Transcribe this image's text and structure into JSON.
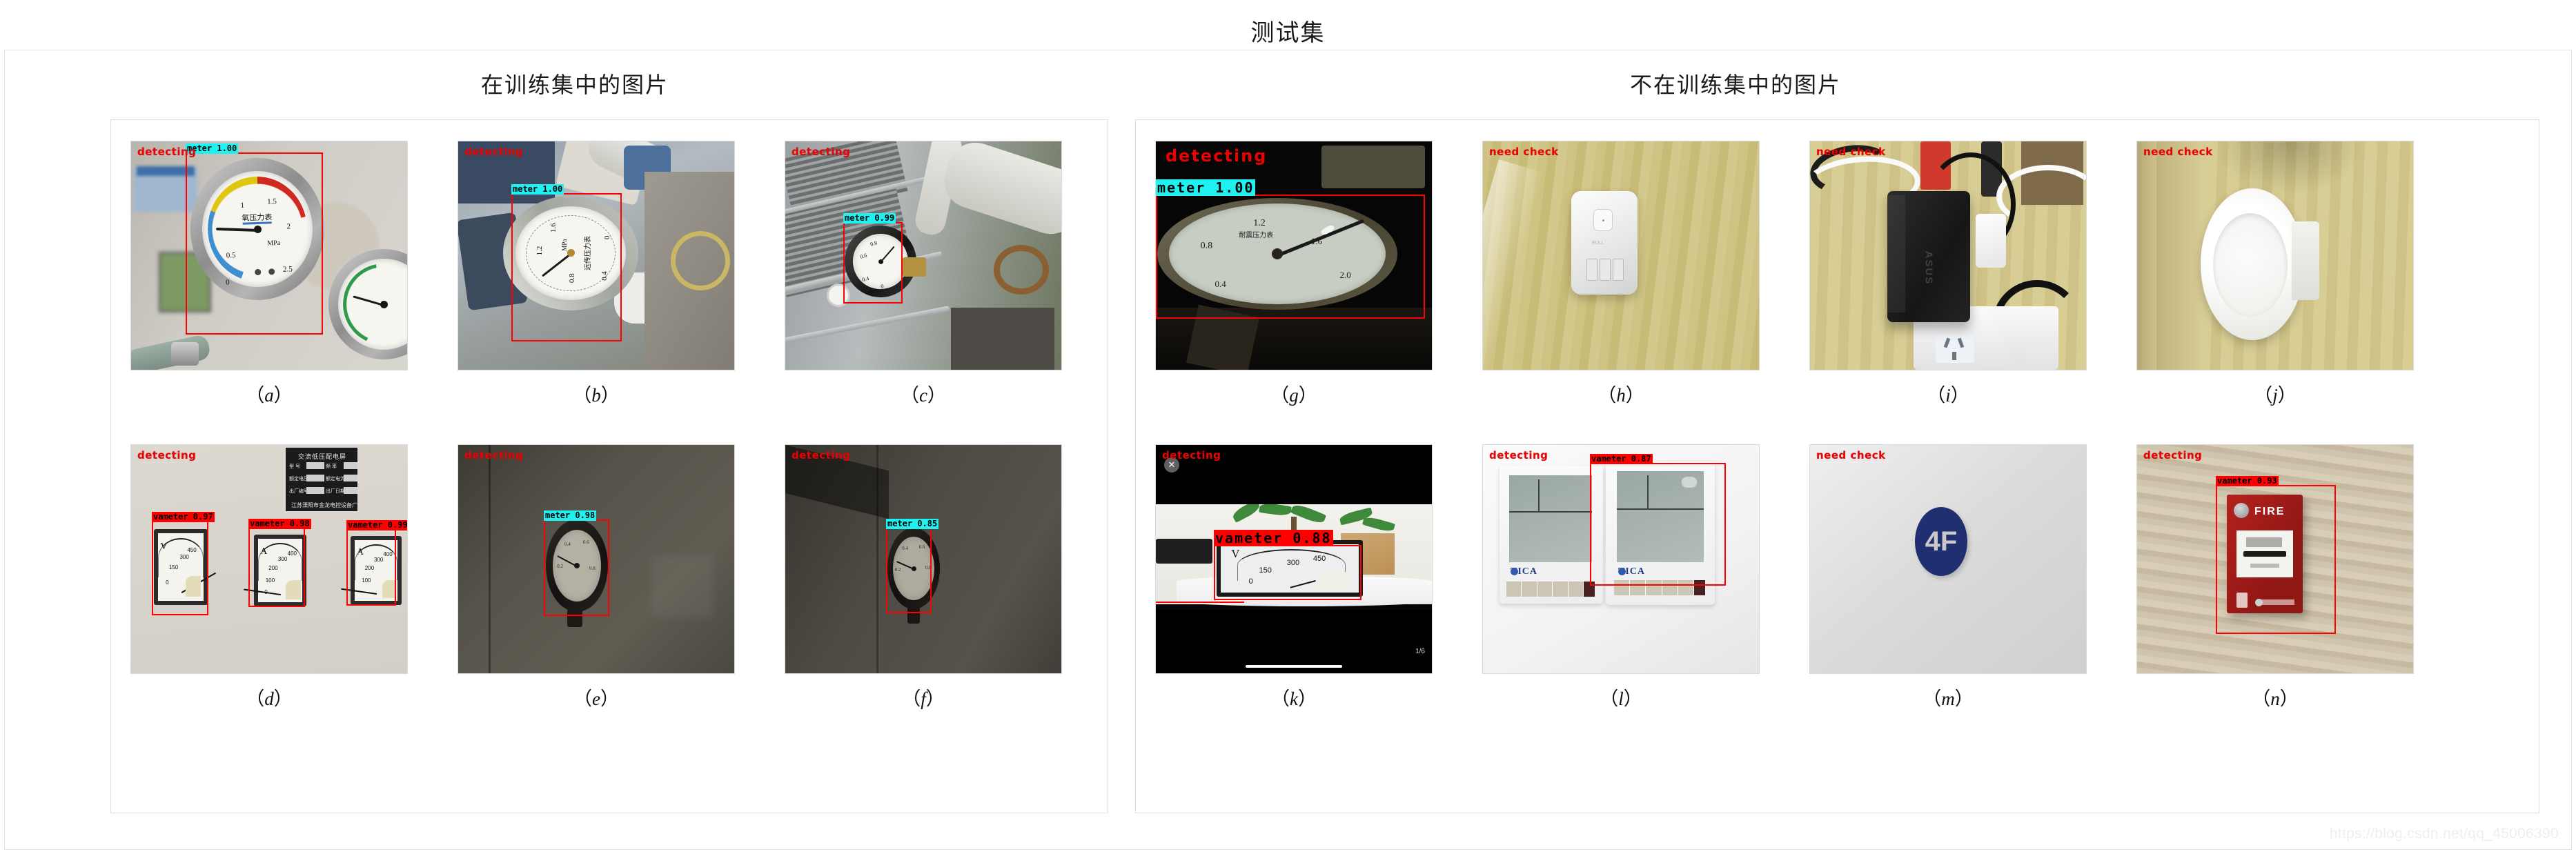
{
  "page": {
    "title": "测试集",
    "watermark": "https://blog.csdn.net/qq_45006390"
  },
  "sections": {
    "left_header": "在训练集中的图片",
    "right_header": "不在训练集中的图片"
  },
  "labels": {
    "detecting": "detecting",
    "need_check": "need check"
  },
  "figures": [
    {
      "id": "a",
      "caption_letter": "a",
      "status": "detecting",
      "status_color": "#ee0000",
      "detections": [
        {
          "label": "meter 1.00",
          "class": "meter",
          "score": "1.00",
          "color": "cyan"
        }
      ],
      "scene": "oxygen pressure gauge on regulator, blurred lab background"
    },
    {
      "id": "b",
      "caption_letter": "b",
      "status": "detecting",
      "status_color": "#ee0000",
      "detections": [
        {
          "label": "meter 1.00",
          "class": "meter",
          "score": "1.00",
          "color": "cyan"
        }
      ],
      "scene": "rotated remote transmission pressure gauge on pump piping"
    },
    {
      "id": "c",
      "caption_letter": "c",
      "status": "detecting",
      "status_color": "#ee0000",
      "detections": [
        {
          "label": "meter 0.99",
          "class": "meter",
          "score": "0.99",
          "color": "cyan"
        }
      ],
      "scene": "small black pressure gauge on outdoor pipe rack"
    },
    {
      "id": "d",
      "caption_letter": "d",
      "status": "detecting",
      "status_color": "#ee0000",
      "detections": [
        {
          "label": "vameter 0.97",
          "class": "vameter",
          "score": "0.97",
          "color": "red"
        },
        {
          "label": "vameter 0.98",
          "class": "vameter",
          "score": "0.98",
          "color": "red"
        },
        {
          "label": "vameter 0.99",
          "class": "vameter",
          "score": "0.99",
          "color": "red"
        }
      ],
      "scene": "three panel meters (V, A, A) on switchgear cabinet with nameplate"
    },
    {
      "id": "e",
      "caption_letter": "e",
      "status": "detecting",
      "status_color": "#ee0000",
      "detections": [
        {
          "label": "meter 0.98",
          "class": "meter",
          "score": "0.98",
          "color": "cyan"
        }
      ],
      "scene": "pressure gauge on dim wall"
    },
    {
      "id": "f",
      "caption_letter": "f",
      "status": "detecting",
      "status_color": "#ee0000",
      "detections": [
        {
          "label": "meter 0.85",
          "class": "meter",
          "score": "0.85",
          "color": "cyan"
        }
      ],
      "scene": "pressure gauge on dark wall"
    },
    {
      "id": "g",
      "caption_letter": "g",
      "status": "detecting",
      "status_color": "#ee0000",
      "detections": [
        {
          "label": "meter 1.00",
          "class": "meter",
          "score": "1.00",
          "color": "cyan"
        }
      ],
      "scene": "large close-up gauge in very dark room"
    },
    {
      "id": "h",
      "caption_letter": "h",
      "status": "need check",
      "status_color": "#ee0000",
      "detections": [],
      "scene": "white BULL usb charger on wooden desk"
    },
    {
      "id": "i",
      "caption_letter": "i",
      "status": "need check",
      "status_color": "#ee0000",
      "detections": [],
      "scene": "black ASUS power adapter on power strip with cables"
    },
    {
      "id": "j",
      "caption_letter": "j",
      "status": "need check",
      "status_color": "#ee0000",
      "detections": [],
      "scene": "white plastic vent cap on wooden panel"
    },
    {
      "id": "k",
      "caption_letter": "k",
      "status": "detecting",
      "status_color": "#ee0000",
      "detections": [
        {
          "label": "vameter 0.88",
          "class": "vameter",
          "score": "0.88",
          "color": "red"
        }
      ],
      "scene": "phone video of voltmeter on desk with plant, letterboxed",
      "overlay": {
        "counter": "1/6",
        "close": "✕"
      }
    },
    {
      "id": "l",
      "caption_letter": "l",
      "status": "detecting",
      "status_color": "#ee0000",
      "detections": [
        {
          "label": "vameter 0.87",
          "class": "vameter",
          "score": "0.87",
          "color": "red"
        }
      ],
      "scene": "two TICA wall thermostats",
      "brand": "TICA"
    },
    {
      "id": "m",
      "caption_letter": "m",
      "status": "need check",
      "status_color": "#ee0000",
      "detections": [],
      "scene": "4F floor sign on white wall",
      "sign_text": "4F"
    },
    {
      "id": "n",
      "caption_letter": "n",
      "status": "detecting",
      "status_color": "#ee0000",
      "detections": [
        {
          "label": "vameter 0.93",
          "class": "vameter",
          "score": "0.93",
          "color": "red"
        }
      ],
      "scene": "red FIRE manual call point on marble wall",
      "sign_text": "FIRE"
    }
  ],
  "gauge_a": {
    "dial_title": "氧压力表",
    "unit": "MPa",
    "ticks": [
      "0",
      "0.5",
      "1",
      "1.5",
      "2",
      "2.5"
    ]
  },
  "gauge_b": {
    "dial_title": "远传压力表",
    "unit": "MPa",
    "ticks": [
      "0",
      "0.4",
      "0.8",
      "1.2",
      "1.6"
    ]
  },
  "meter_d": {
    "units": [
      "V",
      "A",
      "A"
    ],
    "ticks_v": [
      "0",
      "150",
      "300",
      "450"
    ],
    "ticks_a": [
      "0",
      "100",
      "200",
      "300",
      "400"
    ]
  },
  "meter_k": {
    "unit": "V",
    "ticks": [
      "0",
      "150",
      "300",
      "450"
    ]
  },
  "nameplate_d": {
    "title": "交流低压配电屏",
    "rows": [
      "型  号",
      "频  率",
      "额定电压",
      "额定电流",
      "出厂编号",
      "出厂日期"
    ],
    "footer": "江苏溧阳市金龙电控设备厂"
  }
}
